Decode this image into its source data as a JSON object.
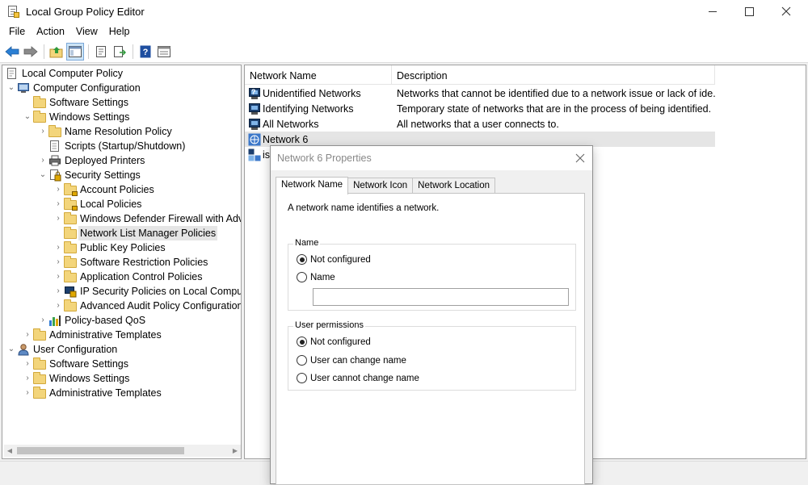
{
  "window": {
    "title": "Local Group Policy Editor"
  },
  "menu": [
    "File",
    "Action",
    "View",
    "Help"
  ],
  "toolbar": {
    "icons": [
      "back-arrow-icon",
      "forward-arrow-icon",
      "up-folder-icon",
      "show-hide-tree-icon",
      "properties-icon",
      "export-list-icon",
      "help-icon",
      "console-view-icon"
    ]
  },
  "tree": {
    "items": [
      {
        "label": "Local Computer Policy"
      },
      {
        "label": "Computer Configuration"
      },
      {
        "label": "Software Settings"
      },
      {
        "label": "Windows Settings"
      },
      {
        "label": "Name Resolution Policy"
      },
      {
        "label": "Scripts (Startup/Shutdown)"
      },
      {
        "label": "Deployed Printers"
      },
      {
        "label": "Security Settings"
      },
      {
        "label": "Account Policies"
      },
      {
        "label": "Local Policies"
      },
      {
        "label": "Windows Defender Firewall with Adv"
      },
      {
        "label": "Network List Manager Policies"
      },
      {
        "label": "Public Key Policies"
      },
      {
        "label": "Software Restriction Policies"
      },
      {
        "label": "Application Control Policies"
      },
      {
        "label": "IP Security Policies on Local Comput"
      },
      {
        "label": "Advanced Audit Policy Configuration"
      },
      {
        "label": "Policy-based QoS"
      },
      {
        "label": "Administrative Templates"
      },
      {
        "label": "User Configuration"
      },
      {
        "label": "Software Settings"
      },
      {
        "label": "Windows Settings"
      },
      {
        "label": "Administrative Templates"
      }
    ]
  },
  "list": {
    "columns": [
      "Network Name",
      "Description"
    ],
    "rows": [
      {
        "name": "Unidentified Networks",
        "description": "Networks that cannot be identified due to a network issue or lack of ide..."
      },
      {
        "name": "Identifying Networks",
        "description": "Temporary state of networks that are in the process of being identified."
      },
      {
        "name": "All Networks",
        "description": "All networks that a user connects to."
      },
      {
        "name": "Network 6",
        "description": ""
      },
      {
        "name": "is",
        "description": ""
      }
    ]
  },
  "dialog": {
    "title": "Network 6 Properties",
    "tabs": [
      "Network Name",
      "Network Icon",
      "Network Location"
    ],
    "intro": "A network name identifies a network.",
    "name_group": {
      "label": "Name",
      "options": [
        "Not configured",
        "Name"
      ],
      "selected": "Not configured",
      "name_value": ""
    },
    "permissions_group": {
      "label": "User permissions",
      "options": [
        "Not configured",
        "User can change name",
        "User cannot change name"
      ],
      "selected": "Not configured"
    }
  }
}
